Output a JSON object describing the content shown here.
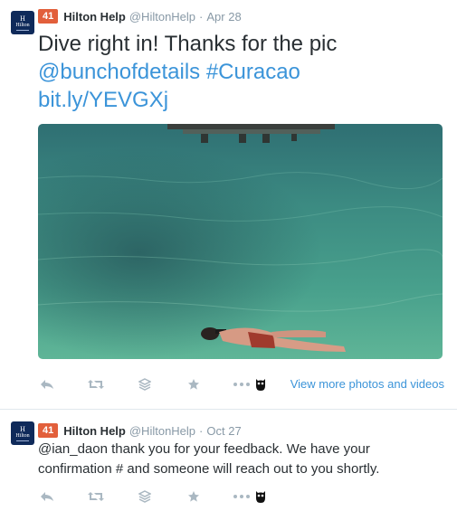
{
  "colors": {
    "link": "#3b94d9",
    "meta": "#8899a6",
    "klout": "#e25f3b",
    "icon": "#aab8c2"
  },
  "tweets": [
    {
      "avatar": {
        "brand": "Hilton"
      },
      "klout_score": "41",
      "name": "Hilton Help",
      "handle": "@HiltonHelp",
      "separator": "·",
      "time": "Apr 28",
      "text_main": "Dive right in! Thanks for the pic",
      "mention": "@bunchofdetails",
      "hashtag": "#Curacao",
      "link": "bit.ly/YEVGXj",
      "media_link": "View more photos and videos",
      "actions": [
        "reply-icon",
        "retweet-icon",
        "buffer-icon",
        "favorite-icon",
        "more-icon",
        "hootsuite-owl-icon"
      ]
    },
    {
      "avatar": {
        "brand": "Hilton"
      },
      "klout_score": "41",
      "name": "Hilton Help",
      "handle": "@HiltonHelp",
      "separator": "·",
      "time": "Oct 27",
      "text": "@ian_daon thank you for your feedback. We have your confirmation # and someone will reach out to you shortly.",
      "actions": [
        "reply-icon",
        "retweet-icon",
        "buffer-icon",
        "favorite-icon",
        "more-icon",
        "hootsuite-owl-icon"
      ]
    }
  ]
}
